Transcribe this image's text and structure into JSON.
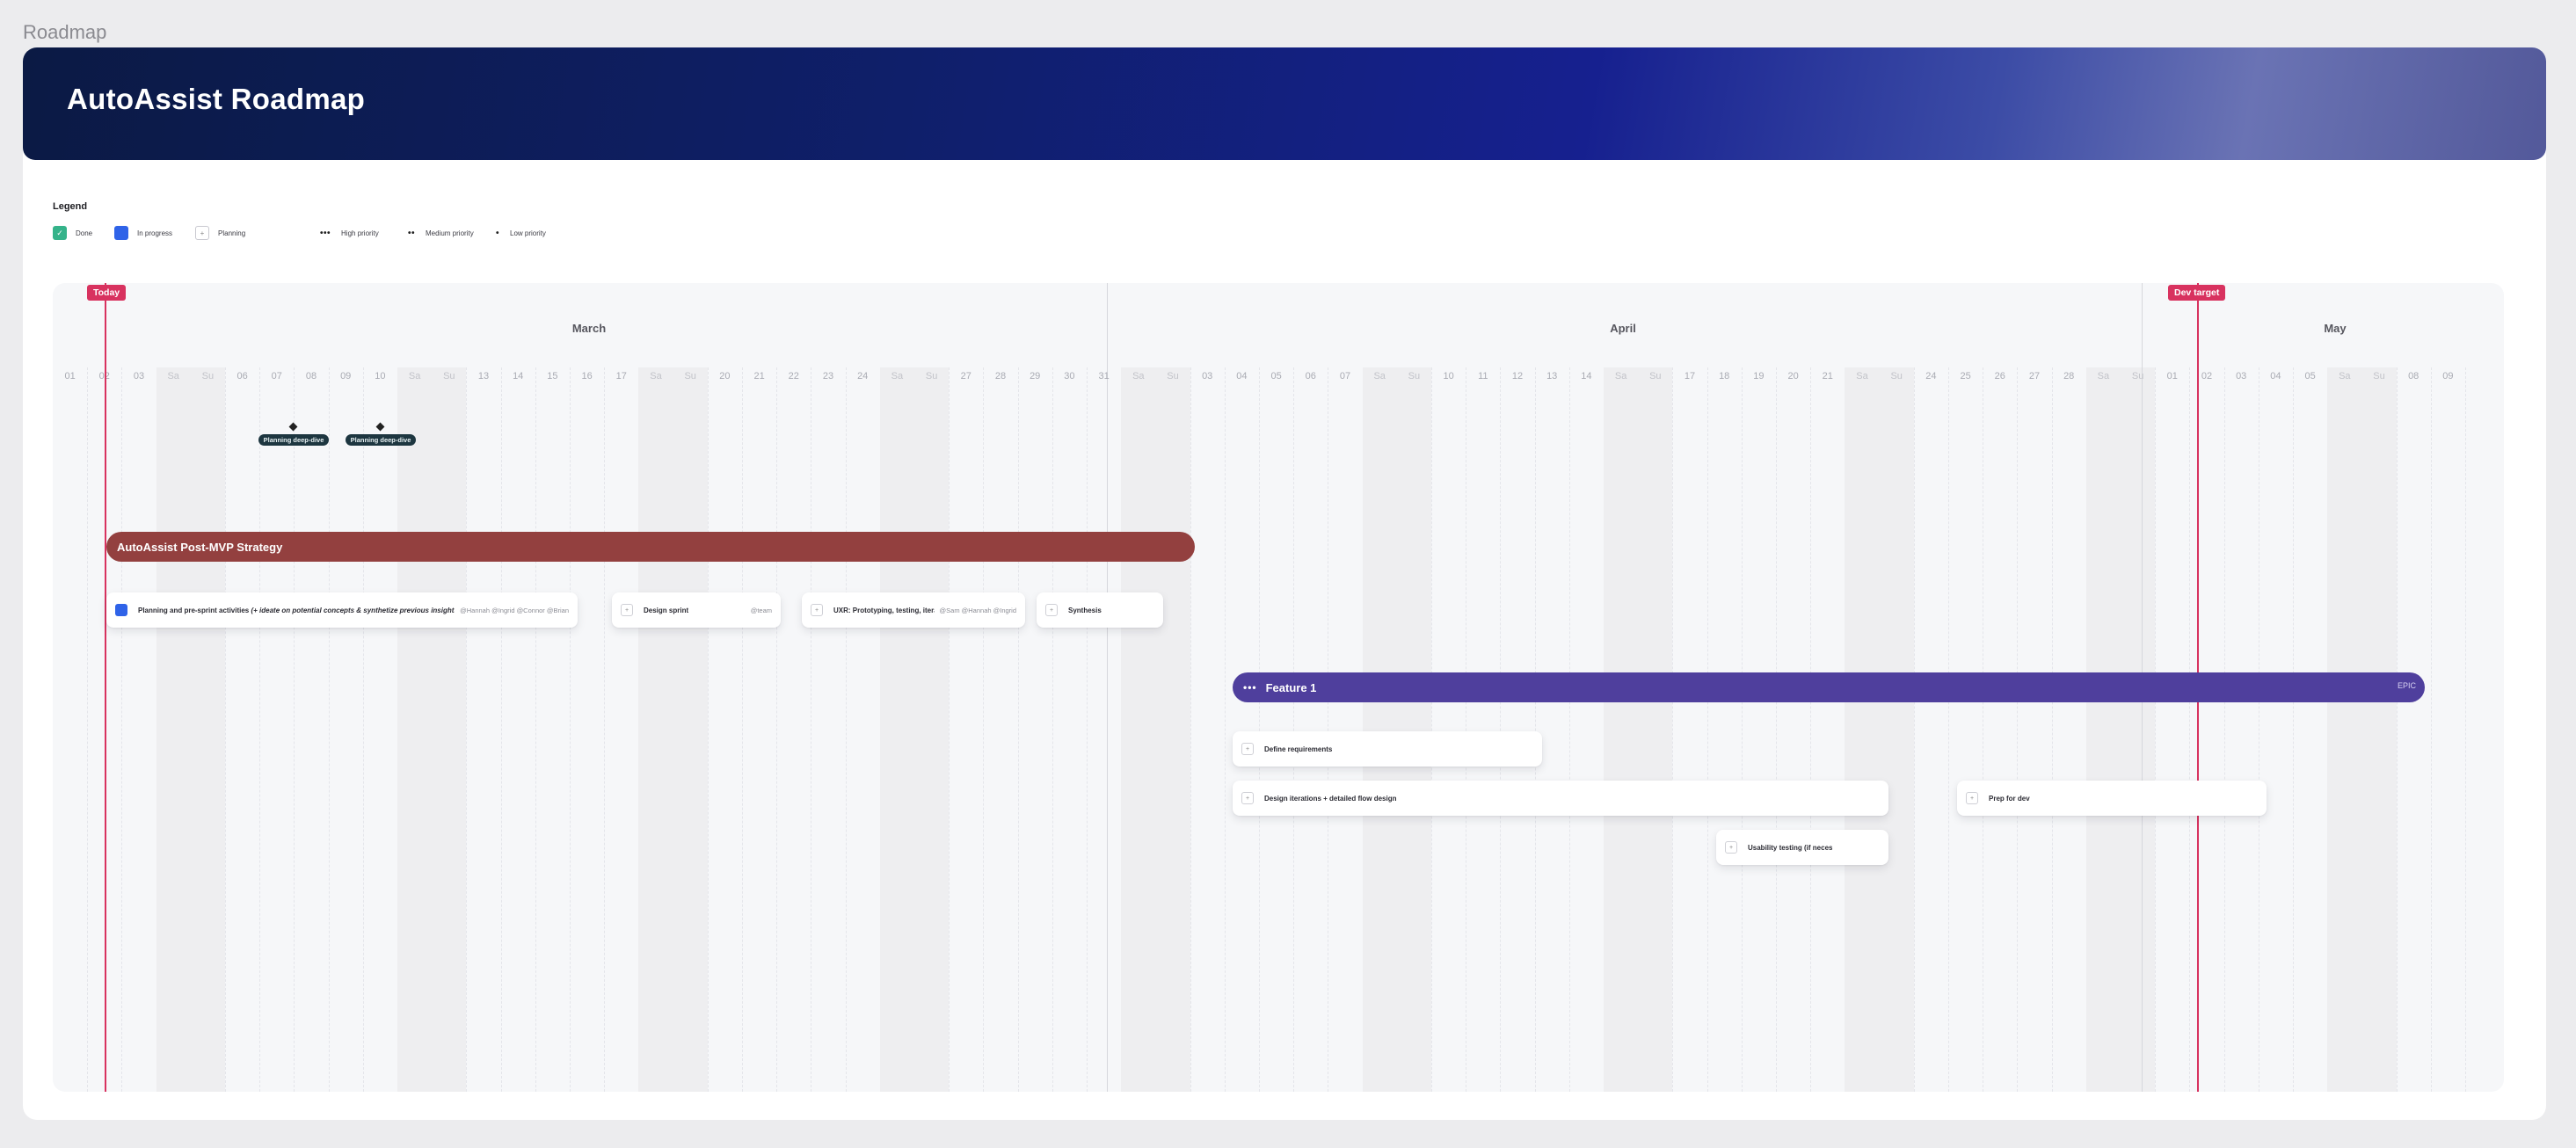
{
  "window": {
    "title": "Roadmap"
  },
  "banner": {
    "title": "AutoAssist Roadmap"
  },
  "legend": {
    "title": "Legend",
    "status": [
      {
        "key": "done",
        "label": "Done",
        "icon": "check-icon"
      },
      {
        "key": "in_progress",
        "label": "In progress",
        "icon": "filled-square-icon"
      },
      {
        "key": "planning",
        "label": "Planning",
        "icon": "empty-square-icon"
      }
    ],
    "priority": [
      {
        "key": "high",
        "label": "High priority",
        "dots": "•••"
      },
      {
        "key": "medium",
        "label": "Medium priority",
        "dots": "••"
      },
      {
        "key": "low",
        "label": "Low priority",
        "dots": "•"
      }
    ]
  },
  "timeline": {
    "months": [
      {
        "name": "March"
      },
      {
        "name": "April"
      },
      {
        "name": "May"
      }
    ],
    "days": [
      "01",
      "02",
      "03",
      "Sa",
      "Su",
      "06",
      "07",
      "08",
      "09",
      "10",
      "Sa",
      "Su",
      "13",
      "14",
      "15",
      "16",
      "17",
      "Sa",
      "Su",
      "20",
      "21",
      "22",
      "23",
      "24",
      "Sa",
      "Su",
      "27",
      "28",
      "29",
      "30",
      "31",
      "Sa",
      "Su",
      "03",
      "04",
      "05",
      "06",
      "07",
      "Sa",
      "Su",
      "10",
      "11",
      "12",
      "13",
      "14",
      "Sa",
      "Su",
      "17",
      "18",
      "19",
      "20",
      "21",
      "Sa",
      "Su",
      "24",
      "25",
      "26",
      "27",
      "28",
      "Sa",
      "Su",
      "01",
      "02",
      "03",
      "04",
      "05",
      "Sa",
      "Su",
      "08",
      "09"
    ],
    "markers": {
      "today": {
        "label": "Today"
      },
      "dev_target": {
        "label": "Dev target"
      }
    },
    "milestones": [
      {
        "label": "Planning deep-dive"
      },
      {
        "label": "Planning deep-dive"
      }
    ],
    "epics": [
      {
        "title": "AutoAssist Post-MVP Strategy",
        "color": "#93403f"
      },
      {
        "title": "Feature 1",
        "color": "#4f3f9d",
        "priority": "•••",
        "badge": "EPIC"
      }
    ],
    "tasks": [
      {
        "status": "in_progress",
        "label_main": "Planning and pre-sprint activities",
        "label_sub": "(+ ideate on potential concepts & synthetize previous insights)",
        "assignees": "@Hannah @Ingrid @Connor @Brian"
      },
      {
        "status": "planning",
        "label": "Design sprint",
        "assignees": "@team"
      },
      {
        "status": "planning",
        "label": "UXR: Prototyping, testing, iterat",
        "assignees": "@Sam @Hannah @Ingrid"
      },
      {
        "status": "planning",
        "label": "Synthesis",
        "assignees": ""
      },
      {
        "status": "planning",
        "label": "Define requirements",
        "assignees": ""
      },
      {
        "status": "planning",
        "label": "Design iterations + detailed flow design",
        "assignees": ""
      },
      {
        "status": "planning",
        "label": "Prep for dev",
        "assignees": ""
      },
      {
        "status": "planning",
        "label": "Usability testing (if neces",
        "assignees": ""
      }
    ]
  }
}
